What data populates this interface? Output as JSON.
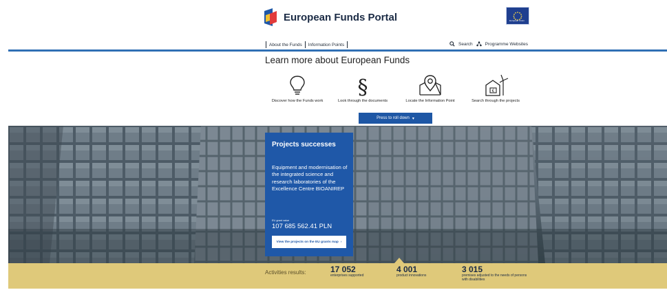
{
  "header": {
    "brand": "European Funds Portal",
    "eu_caption": "European Union",
    "nav": [
      "About the Funds",
      "Information Points"
    ],
    "search_label": "Search",
    "programme_websites_label": "Programme Websites"
  },
  "learn": {
    "title": "Learn more about European Funds",
    "features": [
      {
        "label": "Discover how the Funds work",
        "icon": "lightbulb-icon"
      },
      {
        "label": "Look through the documents",
        "icon": "paragraph-icon"
      },
      {
        "label": "Locate the Information Point",
        "icon": "map-pin-icon"
      },
      {
        "label": "Search through the projects",
        "icon": "wind-turbine-icon"
      }
    ],
    "rolldown_label": "Press to roll down"
  },
  "card": {
    "title": "Projects successes",
    "description": "Equipment and modernisation of the integrated science and research laboratories of the Excellence Centre BIOANIREP",
    "value_label": "EU grant value",
    "value": "107 685 562.41 PLN",
    "button_label": "View the projects on the EU grants map"
  },
  "results": {
    "label": "Activities results:",
    "stats": [
      {
        "number": "17 052",
        "caption": "enterprises supported"
      },
      {
        "number": "4 001",
        "caption": "product innovations"
      },
      {
        "number": "3 015",
        "caption": "premises adjusted to the needs of persons with disabilities"
      }
    ]
  },
  "colors": {
    "nav_rule": "#2f6fb4",
    "card_blue": "#1f58a8",
    "results_band": "#dfc97a"
  }
}
